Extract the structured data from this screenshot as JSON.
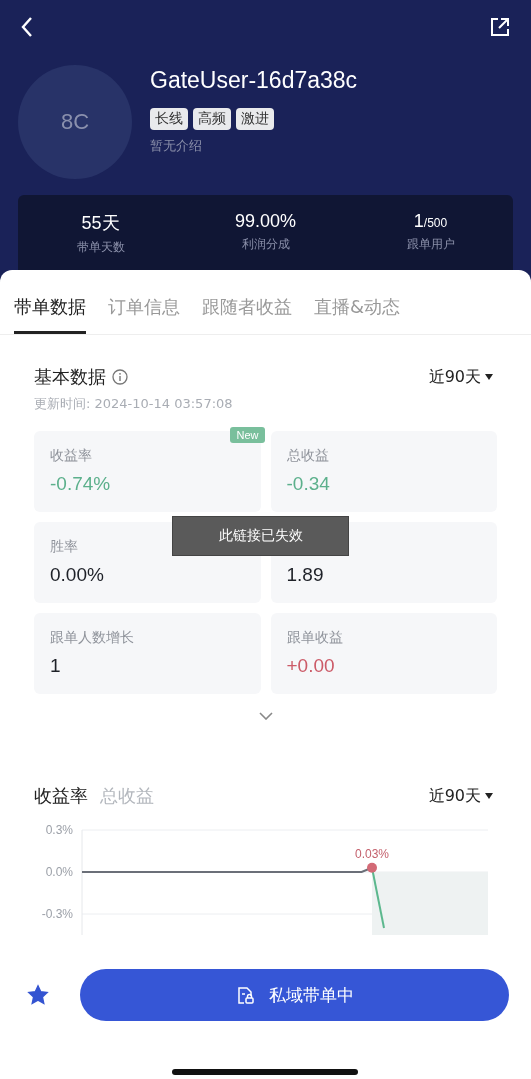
{
  "profile": {
    "avatar_initials": "8C",
    "name": "GateUser-16d7a38c",
    "tags": [
      "长线",
      "高频",
      "激进"
    ],
    "bio": "暂无介绍"
  },
  "stats": [
    {
      "value": "55天",
      "label": "带单天数"
    },
    {
      "value": "99.00%",
      "label": "利润分成"
    },
    {
      "value": "1",
      "suffix": "/500",
      "label": "跟单用户"
    }
  ],
  "tabs": [
    {
      "label": "带单数据",
      "selected": true
    },
    {
      "label": "订单信息",
      "selected": false
    },
    {
      "label": "跟随者收益",
      "selected": false
    },
    {
      "label": "直播&动态",
      "selected": false
    }
  ],
  "basic": {
    "title": "基本数据",
    "period": "近90天",
    "updated": "更新时间: 2024-10-14 03:57:08",
    "cards": [
      {
        "label": "收益率",
        "value": "-0.74%",
        "color": "#5cb08c",
        "badge": "New"
      },
      {
        "label": "总收益",
        "value": "-0.34",
        "color": "#5cb08c"
      },
      {
        "label": "胜率",
        "value": "0.00%",
        "color": "#1e2128"
      },
      {
        "value": "1.89",
        "color": "#1e2128"
      },
      {
        "label": "跟单人数增长",
        "value": "1",
        "color": "#1e2128"
      },
      {
        "label": "跟单收益",
        "value": "+0.00",
        "color": "#cc5b68"
      }
    ]
  },
  "toast": "此链接已失效",
  "chart_section": {
    "tabs": [
      {
        "label": "收益率",
        "selected": true
      },
      {
        "label": "总收益",
        "selected": false
      }
    ],
    "period": "近90天",
    "chart_data": {
      "type": "line",
      "grid": true,
      "ylim": [
        -0.45,
        0.3
      ],
      "yticks": [
        {
          "value": 0.3,
          "label": "0.3%"
        },
        {
          "value": 0,
          "label": "0.0%"
        },
        {
          "value": -0.3,
          "label": "-0.3%"
        }
      ],
      "series": [
        {
          "color": "#6b6f78",
          "values": [
            0,
            0,
            0,
            0,
            0,
            0,
            0,
            0,
            0,
            0,
            0,
            0,
            0,
            0,
            0,
            0,
            0,
            0,
            0,
            0,
            0,
            0,
            0,
            0,
            0,
            0,
            0,
            0,
            0.03,
            null
          ]
        },
        {
          "color": "#5cb88e",
          "values": [
            null,
            null,
            null,
            null,
            null,
            null,
            null,
            null,
            null,
            null,
            null,
            null,
            null,
            null,
            null,
            null,
            null,
            null,
            null,
            null,
            null,
            null,
            null,
            null,
            null,
            null,
            null,
            null,
            0.03,
            -0.4
          ]
        }
      ],
      "annotations": [
        {
          "text": "0.03%",
          "y": 0.03
        }
      ]
    }
  },
  "bottom": {
    "favorited": true,
    "button": "私域带单中"
  }
}
